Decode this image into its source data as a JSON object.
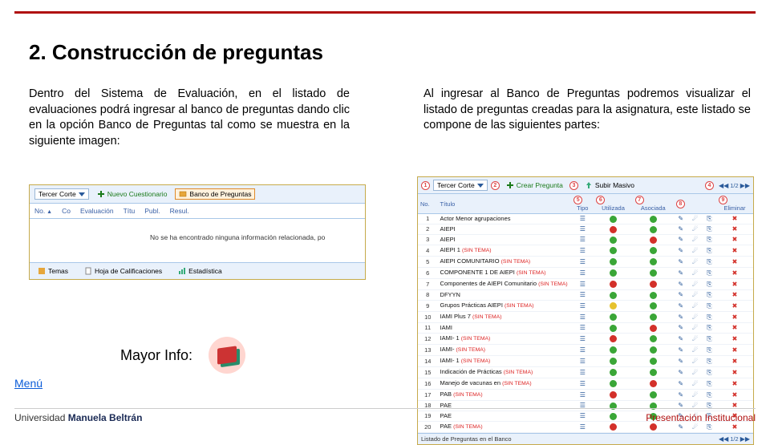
{
  "title": "2. Construcción de preguntas",
  "left_text": "Dentro del Sistema de Evaluación, en el listado de evaluaciones podrá ingresar al banco de preguntas dando clic en la opción Banco de Preguntas tal como se muestra en la siguiente imagen:",
  "right_text": "Al ingresar al Banco de Preguntas podremos visualizar el listado de preguntas creadas para la asignatura, este listado se compone de las siguientes partes:",
  "shot1": {
    "selector": "Tercer Corte",
    "nuevo": "Nuevo Cuestionario",
    "banco": "Banco de Preguntas",
    "cols": [
      "No.",
      "Co",
      "Evaluación",
      "Títu",
      "Publ.",
      "Resul."
    ],
    "msg": "No se ha encontrado ninguna información relacionada, po",
    "foot": [
      "Temas",
      "Hoja de Calificaciones",
      "Estadística"
    ]
  },
  "mayor_label": "Mayor Info:",
  "menu": "Menú",
  "shot2": {
    "selector": "Tercer Corte",
    "crear": "Crear Pregunta",
    "subir": "Subir Masivo",
    "pager": "1/2",
    "hdr": {
      "no": "No.",
      "titulo": "Título",
      "tipo": "Tipo",
      "utilizada": "Utilizada",
      "asociada": "Asociada",
      "eliminar": "Eliminar"
    },
    "rows": [
      {
        "n": 1,
        "t": "Actor Menor agrupaciones",
        "u": "g",
        "a": "g"
      },
      {
        "n": 2,
        "t": "AIEPI",
        "u": "r",
        "a": "g"
      },
      {
        "n": 3,
        "t": "AIEPI",
        "u": "g",
        "a": "r"
      },
      {
        "n": 4,
        "t": "AIEPI 1 (SIN TEMA)",
        "u": "g",
        "a": "g"
      },
      {
        "n": 5,
        "t": "AIEPI COMUNITARIO (SIN TEMA)",
        "u": "g",
        "a": "g"
      },
      {
        "n": 6,
        "t": "COMPONENTE 1 DE AIEPI (SIN TEMA)",
        "u": "g",
        "a": "g"
      },
      {
        "n": 7,
        "t": "Componentes de AIEPI Comunitario (SIN TEMA)",
        "u": "r",
        "a": "r"
      },
      {
        "n": 8,
        "t": "DFYYN",
        "u": "g",
        "a": "g"
      },
      {
        "n": 9,
        "t": "Grupos Prácticas AIEPI (SIN TEMA)",
        "u": "y",
        "a": "g"
      },
      {
        "n": 10,
        "t": "IAMI Plus 7 (SIN TEMA)",
        "u": "g",
        "a": "g"
      },
      {
        "n": 11,
        "t": "IAMI",
        "u": "g",
        "a": "r"
      },
      {
        "n": 12,
        "t": "IAMI- 1 (SIN TEMA)",
        "u": "r",
        "a": "g"
      },
      {
        "n": 13,
        "t": "IAMI- (SIN TEMA)",
        "u": "g",
        "a": "g"
      },
      {
        "n": 14,
        "t": "IAMI- 1 (SIN TEMA)",
        "u": "g",
        "a": "g"
      },
      {
        "n": 15,
        "t": "Indicación de Prácticas (SIN TEMA)",
        "u": "g",
        "a": "g"
      },
      {
        "n": 16,
        "t": "Manejo de vacunas en (SIN TEMA)",
        "u": "g",
        "a": "r"
      },
      {
        "n": 17,
        "t": "PAB (SIN TEMA)",
        "u": "r",
        "a": "g"
      },
      {
        "n": 18,
        "t": "PAE",
        "u": "g",
        "a": "g"
      },
      {
        "n": 19,
        "t": "PAE",
        "u": "g",
        "a": "g"
      },
      {
        "n": 20,
        "t": "PAE (SIN TEMA)",
        "u": "r",
        "a": "r"
      }
    ],
    "foot": "Listado de Preguntas en el Banco"
  },
  "footer": {
    "uni_pre": "Universidad ",
    "uni_bold": "Manuela Beltrán",
    "pres": "Presentación Institucional"
  }
}
